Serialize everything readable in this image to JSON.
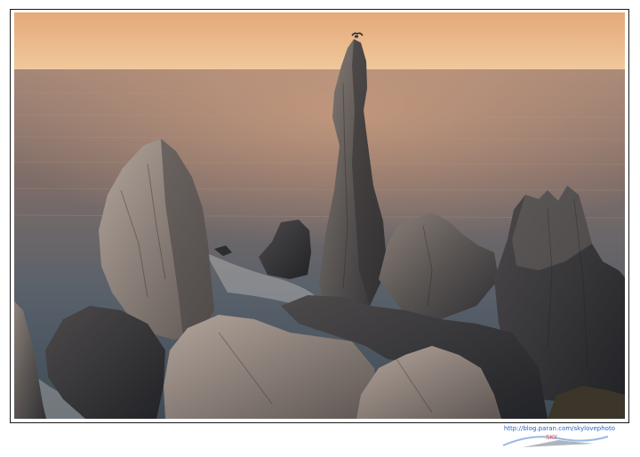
{
  "scene": {
    "subject": "sea-stack-rocks-at-sunset",
    "colors": {
      "sky_top": "#e7b586",
      "sky_bottom": "#dba174",
      "sea_far": "#8f7463",
      "sea_near": "#3f4f58",
      "rock_dark": "#2f2f33",
      "rock_mid": "#5b5755",
      "rock_light": "#9b8f86"
    }
  },
  "watermark": {
    "url": "http://blog.paran.com/skylovephoto",
    "logo_text": "SKY"
  }
}
